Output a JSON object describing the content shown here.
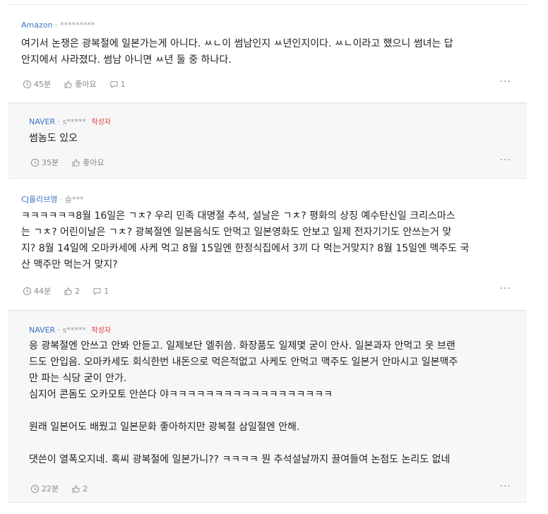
{
  "comments": [
    {
      "author": "Amazon",
      "user": "*********",
      "is_writer": false,
      "body": "여기서 논쟁은 광복절에 일본가는게 아니다. ㅆㄴ이 썸남인지 ㅆ년인지이다. ㅆㄴ이라고 했으니 썸녀는 답\n안지에서 사라졌다. 썸남 아니면 ㅆ년 둘 중 하나다.",
      "time": "45분",
      "like": "좋아요",
      "replies": "1"
    },
    {
      "author": "NAVER",
      "user": "s*****",
      "is_writer": true,
      "writer_badge": "작성자",
      "body": "썸놈도 있오",
      "time": "35분",
      "like": "좋아요",
      "replies": ""
    },
    {
      "author": "CJ올리브영",
      "user": "슬***",
      "is_writer": false,
      "body": "ㅋㅋㅋㅋㅋㅋ8월 16일은 ㄱㅊ? 우리 민족 대명절 추석, 설날은 ㄱㅊ? 평화의 상징 예수탄신일 크리스마스\n는 ㄱㅊ? 어린이날은 ㄱㅊ? 광복절엔 일본음식도 안먹고 일본영화도 안보고 일제 전자기기도 안쓰는거 맞\n지? 8월 14일에 오마카세에 사케 먹고 8월 15일엔 한정식집에서 3끼 다 먹는거맞지? 8월 15일엔 맥주도 국\n산 맥주만 먹는거 맞지?",
      "time": "44분",
      "like": "2",
      "replies": "1"
    },
    {
      "author": "NAVER",
      "user": "s*****",
      "is_writer": true,
      "writer_badge": "작성자",
      "body": "응 광복절엔 안쓰고 안봐 안듣고. 일제보단 엘쥐씀. 화장품도 일제몇 굳이 안사. 일본과자 안먹고 옷 브랜\n드도 안입음. 오마카세도 회식한번 내돈으로 먹은적없고 사케도 안먹고 맥주도 일본거 안마시고 일본맥주\n만 파는 식당 굳이 안가.\n심지어 콘돔도 오카모토 안쓴다 야ㅋㅋㅋㅋㅋㅋㅋㅋㅋㅋㅋㅋㅋㅋㅋㅋㅋㅋ\n\n원래 일본어도 배웠고 일본문화 좋아하지만 광복절 삼일절엔 안해.\n\n댓쓴이 열폭오지네. 혹씨 광복절에 일본가니?? ㅋㅋㅋㅋ 뭔 추석설날까지 끌여들여 논점도 논리도 없네",
      "time": "22분",
      "like": "2",
      "replies": ""
    }
  ],
  "more_label": "···"
}
